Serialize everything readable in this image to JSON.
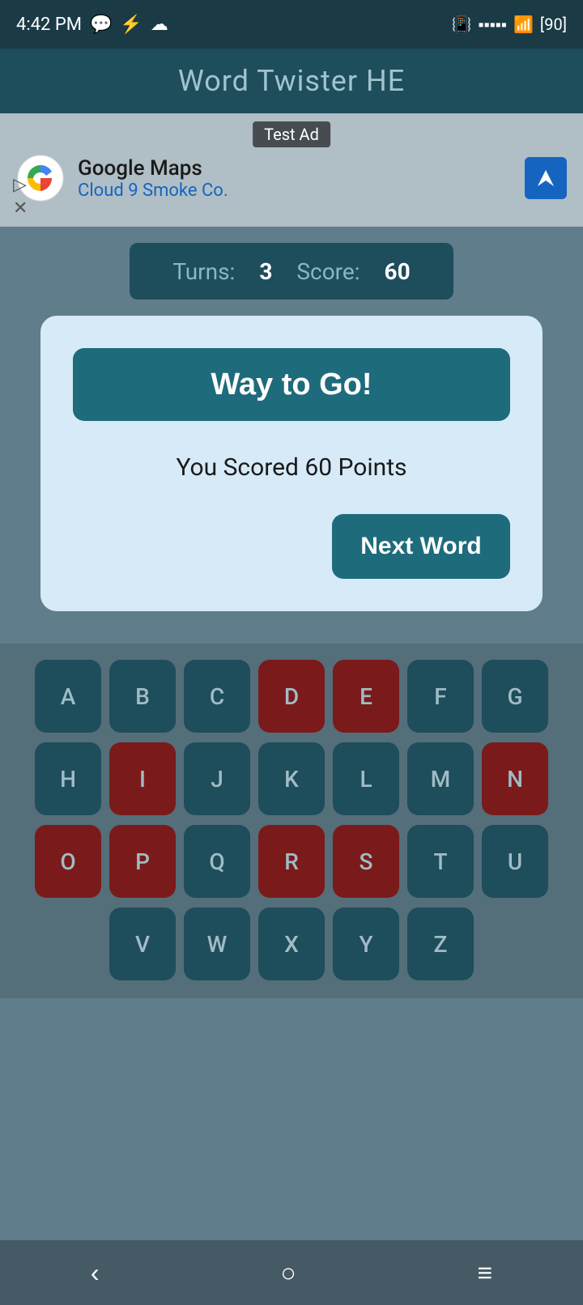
{
  "statusBar": {
    "time": "4:42 PM",
    "battery": "90"
  },
  "titleBar": {
    "title": "Word Twister HE"
  },
  "ad": {
    "label": "Test Ad",
    "advertiser": "Google Maps",
    "location": "Cloud 9 Smoke Co."
  },
  "scoreBar": {
    "turnsLabel": "Turns:",
    "turnsValue": "3",
    "scoreLabel": "Score:",
    "scoreValue": "60"
  },
  "popup": {
    "titleBtn": "Way to Go!",
    "scoreText": "You Scored 60 Points",
    "nextWordBtn": "Next Word"
  },
  "keyboard": {
    "rows": [
      [
        {
          "letter": "A",
          "used": false
        },
        {
          "letter": "B",
          "used": false
        },
        {
          "letter": "C",
          "used": false
        },
        {
          "letter": "D",
          "used": true
        },
        {
          "letter": "E",
          "used": true
        },
        {
          "letter": "F",
          "used": false
        },
        {
          "letter": "G",
          "used": false
        }
      ],
      [
        {
          "letter": "H",
          "used": false
        },
        {
          "letter": "I",
          "used": true
        },
        {
          "letter": "J",
          "used": false
        },
        {
          "letter": "K",
          "used": false
        },
        {
          "letter": "L",
          "used": false
        },
        {
          "letter": "M",
          "used": false
        },
        {
          "letter": "N",
          "used": true
        }
      ],
      [
        {
          "letter": "O",
          "used": true
        },
        {
          "letter": "P",
          "used": true
        },
        {
          "letter": "Q",
          "used": false
        },
        {
          "letter": "R",
          "used": true
        },
        {
          "letter": "S",
          "used": true
        },
        {
          "letter": "T",
          "used": false
        },
        {
          "letter": "U",
          "used": false
        }
      ],
      [
        {
          "letter": "V",
          "used": false
        },
        {
          "letter": "W",
          "used": false
        },
        {
          "letter": "X",
          "used": false
        },
        {
          "letter": "Y",
          "used": false
        },
        {
          "letter": "Z",
          "used": false
        }
      ]
    ]
  },
  "navBar": {
    "back": "‹",
    "home": "○",
    "menu": "≡"
  }
}
